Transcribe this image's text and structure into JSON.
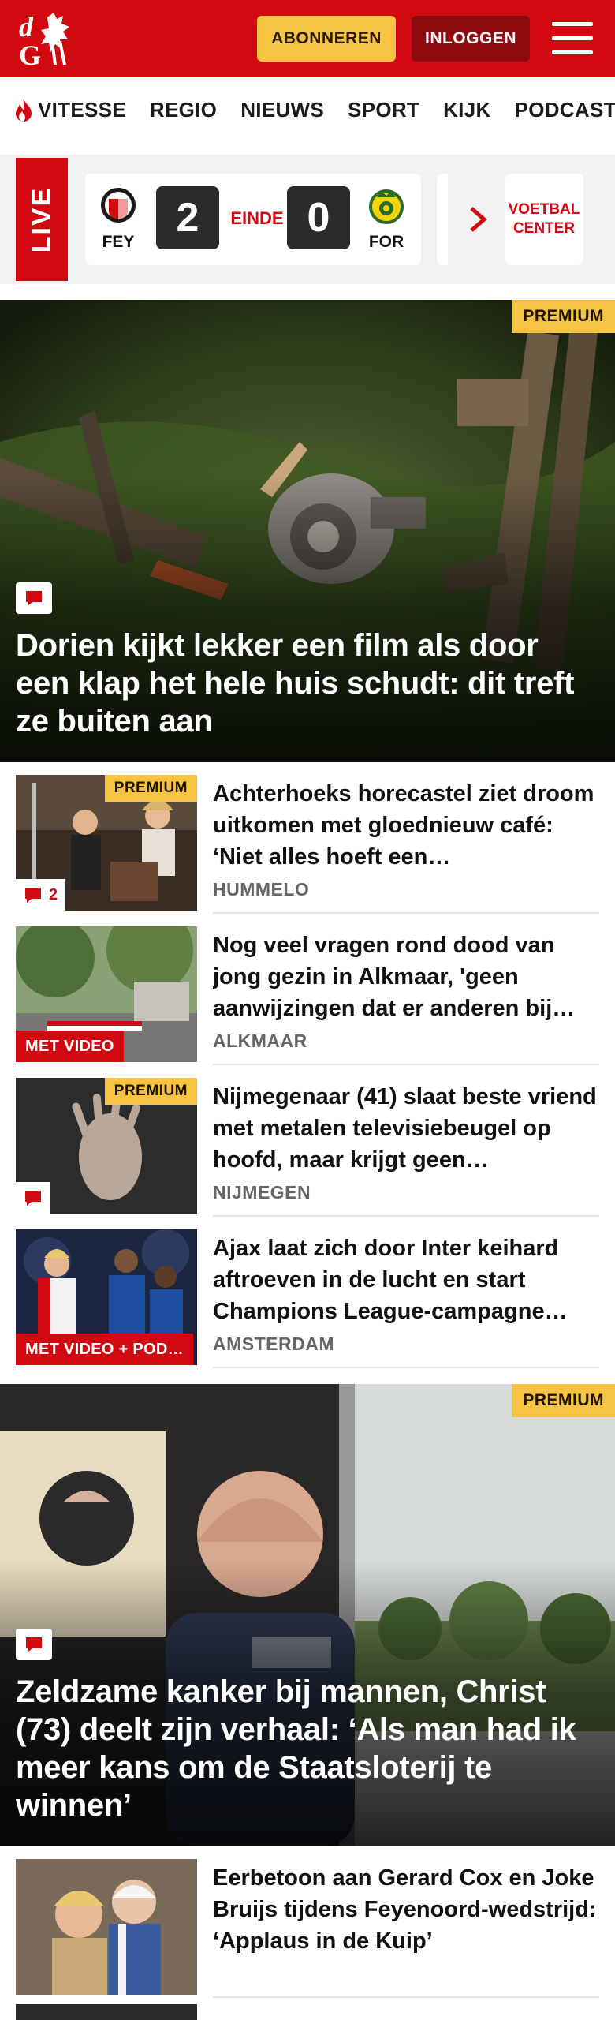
{
  "header": {
    "subscribe_label": "ABONNEREN",
    "login_label": "INLOGGEN",
    "brand_color": "#d10a11",
    "subscribe_color": "#f6c343"
  },
  "nav": {
    "items": [
      {
        "label": "VITESSE",
        "icon": "flame-icon"
      },
      {
        "label": "REGIO"
      },
      {
        "label": "NIEUWS"
      },
      {
        "label": "SPORT"
      },
      {
        "label": "KIJK"
      },
      {
        "label": "PODCAST"
      }
    ]
  },
  "live": {
    "tag": "LIVE",
    "match": {
      "home_code": "FEY",
      "away_code": "FOR",
      "home_score": "2",
      "away_score": "0",
      "status": "EINDE"
    },
    "center_line1": "VOETBAL",
    "center_line2": "CENTER"
  },
  "hero1": {
    "premium": "PREMIUM",
    "title": "Dorien kijkt lekker een film als door een klap het hele huis schudt: dit treft ze buiten aan"
  },
  "articles": [
    {
      "title": "Achterhoeks horecastel ziet droom uitkomen met gloednieuw café: ‘Niet alles hoeft een…",
      "place": "HUMMELO",
      "premium": "PREMIUM",
      "comments": "2"
    },
    {
      "title": "Nog veel vragen rond dood van jong gezin in Alkmaar, 'geen aanwijzingen dat er anderen bij…",
      "place": "ALKMAAR",
      "video": "MET VIDEO"
    },
    {
      "title": "Nijmegenaar (41) slaat beste vriend met metalen televisiebeu­gel op hoofd, maar krijgt geen…",
      "place": "NIJMEGEN",
      "premium": "PREMIUM"
    },
    {
      "title": "Ajax laat zich door Inter keihard aftroeven in de lucht en start Champions League-campagne…",
      "place": "AMSTERDAM",
      "video": "MET VIDEO + POD…"
    }
  ],
  "hero2": {
    "premium": "PREMIUM",
    "title": "Zeldzame kanker bij mannen, Christ (73) deelt zijn verhaal: ‘Als man had ik meer kans om de Staatsloterij te winnen’"
  },
  "articles2": [
    {
      "title": "Eerbetoon aan Gerard Cox en Joke Bruijs tijdens Feyenoord-wedstrijd: ‘Applaus in de Kuip’"
    }
  ]
}
